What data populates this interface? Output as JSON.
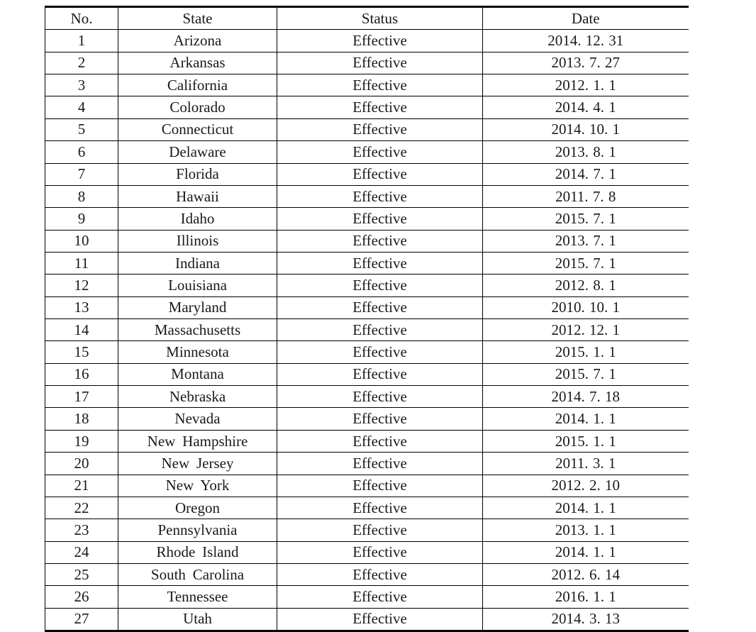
{
  "table": {
    "columns": [
      {
        "key": "no",
        "label": "No."
      },
      {
        "key": "state",
        "label": "State"
      },
      {
        "key": "status",
        "label": "Status"
      },
      {
        "key": "date",
        "label": "Date"
      }
    ],
    "rows": [
      {
        "no": "1",
        "state": "Arizona",
        "status": "Effective",
        "date": "2014. 12. 31"
      },
      {
        "no": "2",
        "state": "Arkansas",
        "status": "Effective",
        "date": "2013. 7. 27"
      },
      {
        "no": "3",
        "state": "California",
        "status": "Effective",
        "date": "2012. 1. 1"
      },
      {
        "no": "4",
        "state": "Colorado",
        "status": "Effective",
        "date": "2014. 4. 1"
      },
      {
        "no": "5",
        "state": "Connecticut",
        "status": "Effective",
        "date": "2014. 10. 1"
      },
      {
        "no": "6",
        "state": "Delaware",
        "status": "Effective",
        "date": "2013. 8. 1"
      },
      {
        "no": "7",
        "state": "Florida",
        "status": "Effective",
        "date": "2014. 7. 1"
      },
      {
        "no": "8",
        "state": "Hawaii",
        "status": "Effective",
        "date": "2011. 7. 8"
      },
      {
        "no": "9",
        "state": "Idaho",
        "status": "Effective",
        "date": "2015. 7. 1"
      },
      {
        "no": "10",
        "state": "Illinois",
        "status": "Effective",
        "date": "2013. 7. 1"
      },
      {
        "no": "11",
        "state": "Indiana",
        "status": "Effective",
        "date": "2015. 7. 1"
      },
      {
        "no": "12",
        "state": "Louisiana",
        "status": "Effective",
        "date": "2012. 8. 1"
      },
      {
        "no": "13",
        "state": "Maryland",
        "status": "Effective",
        "date": "2010. 10. 1"
      },
      {
        "no": "14",
        "state": "Massachusetts",
        "status": "Effective",
        "date": "2012. 12. 1"
      },
      {
        "no": "15",
        "state": "Minnesota",
        "status": "Effective",
        "date": "2015. 1. 1"
      },
      {
        "no": "16",
        "state": "Montana",
        "status": "Effective",
        "date": "2015. 7. 1"
      },
      {
        "no": "17",
        "state": "Nebraska",
        "status": "Effective",
        "date": "2014. 7. 18"
      },
      {
        "no": "18",
        "state": "Nevada",
        "status": "Effective",
        "date": "2014. 1. 1"
      },
      {
        "no": "19",
        "state": "New Hampshire",
        "status": "Effective",
        "date": "2015. 1. 1"
      },
      {
        "no": "20",
        "state": "New Jersey",
        "status": "Effective",
        "date": "2011. 3. 1"
      },
      {
        "no": "21",
        "state": "New York",
        "status": "Effective",
        "date": "2012. 2. 10"
      },
      {
        "no": "22",
        "state": "Oregon",
        "status": "Effective",
        "date": "2014. 1. 1"
      },
      {
        "no": "23",
        "state": "Pennsylvania",
        "status": "Effective",
        "date": "2013. 1. 1"
      },
      {
        "no": "24",
        "state": "Rhode Island",
        "status": "Effective",
        "date": "2014. 1. 1"
      },
      {
        "no": "25",
        "state": "South Carolina",
        "status": "Effective",
        "date": "2012. 6. 14"
      },
      {
        "no": "26",
        "state": "Tennessee",
        "status": "Effective",
        "date": "2016. 1. 1"
      },
      {
        "no": "27",
        "state": "Utah",
        "status": "Effective",
        "date": "2014. 3. 13"
      }
    ]
  }
}
